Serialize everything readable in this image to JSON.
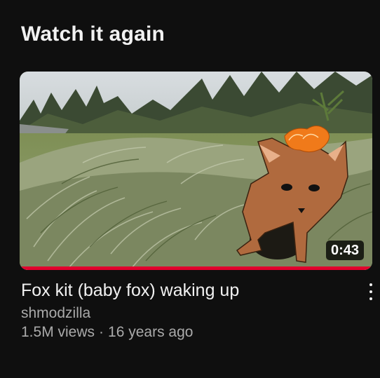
{
  "section": {
    "title": "Watch it again"
  },
  "video": {
    "title": "Fox kit (baby fox) waking up",
    "channel": "shmodzilla",
    "views": "1.5M views",
    "separator": "·",
    "age": "16 years ago",
    "duration": "0:43",
    "watched_fraction": 1.0,
    "thumbnail_subject": "fox-kit-in-grass-with-drawn-cartoon-fox"
  },
  "colors": {
    "background": "#0f0f0f",
    "progress": "#e1002d",
    "primary_text": "#f1f1f1",
    "secondary_text": "#aaaaaa"
  },
  "icons": {
    "more": "more-vert-icon"
  }
}
